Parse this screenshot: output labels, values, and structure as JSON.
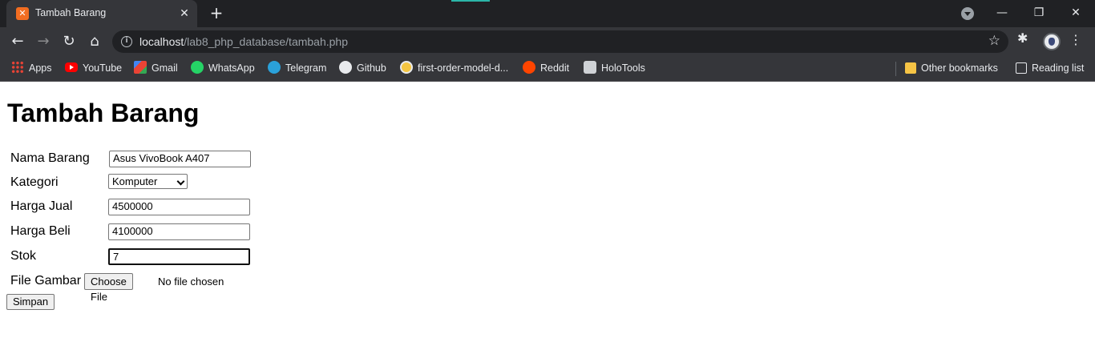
{
  "tab": {
    "title": "Tambah Barang",
    "favicon": "xampp-icon",
    "close": "✕"
  },
  "new_tab": "+",
  "window_controls": {
    "minimize": "—",
    "restore": "❐",
    "close": "✕"
  },
  "toolbar": {
    "back": "←",
    "forward": "→",
    "reload": "↻",
    "home": "⌂",
    "url_host": "localhost",
    "url_path": "/lab8_php_database/tambah.php",
    "bookmark_star": "☆",
    "extensions": "✱",
    "menu": "⋮"
  },
  "bookmarks": {
    "items": [
      {
        "label": "Apps",
        "icon": "apps-grid-icon"
      },
      {
        "label": "YouTube",
        "icon": "youtube-icon"
      },
      {
        "label": "Gmail",
        "icon": "gmail-icon"
      },
      {
        "label": "WhatsApp",
        "icon": "whatsapp-icon"
      },
      {
        "label": "Telegram",
        "icon": "telegram-icon"
      },
      {
        "label": "Github",
        "icon": "github-icon"
      },
      {
        "label": "first-order-model-d...",
        "icon": "first-order-model-icon"
      },
      {
        "label": "Reddit",
        "icon": "reddit-icon"
      },
      {
        "label": "HoloTools",
        "icon": "holotools-icon"
      }
    ],
    "other": "Other bookmarks",
    "reading_list": "Reading list"
  },
  "page": {
    "heading": "Tambah Barang",
    "form": {
      "nama_label": "Nama Barang",
      "nama_value": "Asus VivoBook A407",
      "kategori_label": "Kategori",
      "kategori_value": "Komputer",
      "harga_jual_label": "Harga Jual",
      "harga_jual_value": "4500000",
      "harga_beli_label": "Harga Beli",
      "harga_beli_value": "4100000",
      "stok_label": "Stok",
      "stok_value": "7",
      "gambar_label": "File Gambar",
      "file_button": "Choose File",
      "file_status": "No file chosen",
      "submit": "Simpan"
    }
  },
  "colors": {
    "chrome_dark": "#202124",
    "chrome_toolbar": "#35363a",
    "chrome_text": "#e8eaed",
    "page_bg": "#ffffff"
  }
}
